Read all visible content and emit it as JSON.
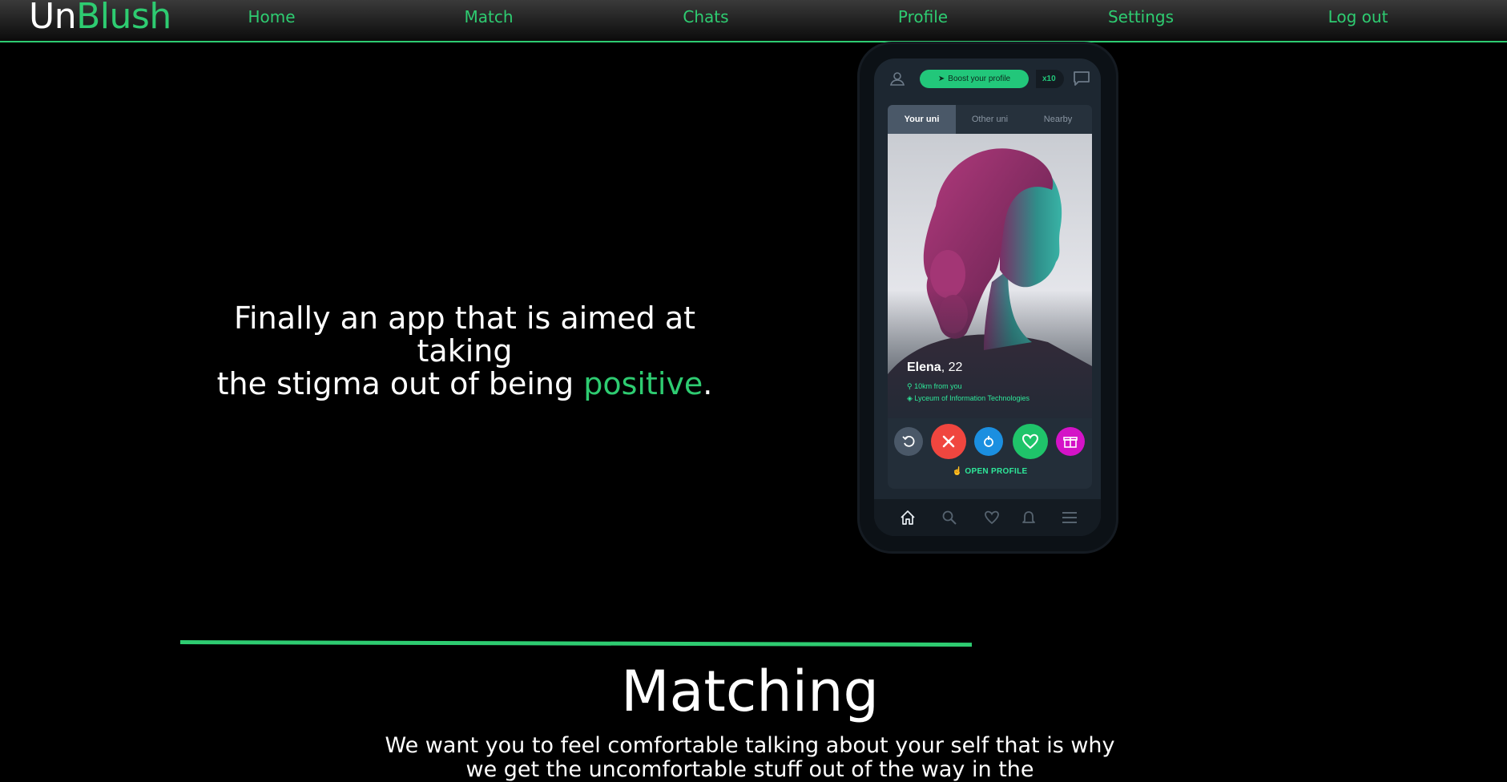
{
  "brand": {
    "part1": "Un",
    "part2": "Blush"
  },
  "nav": [
    {
      "label": "Home"
    },
    {
      "label": "Match"
    },
    {
      "label": "Chats"
    },
    {
      "label": "Profile"
    },
    {
      "label": "Settings"
    },
    {
      "label": "Log out"
    }
  ],
  "hero": {
    "line1": "Finally an app that is aimed at taking",
    "line2_prefix": "the stigma out of being ",
    "line2_accent": "positive",
    "line2_suffix": "."
  },
  "phone": {
    "boost_label": "Boost your profile",
    "boost_count": "x10",
    "tabs": [
      {
        "label": "Your uni",
        "active": true
      },
      {
        "label": "Other uni",
        "active": false
      },
      {
        "label": "Nearby",
        "active": false
      }
    ],
    "profile": {
      "name": "Elena",
      "age": ", 22",
      "distance": "10km from you",
      "school": "Lyceum of Information Technologies"
    },
    "open_profile_label": "OPEN PROFILE",
    "action_icons": [
      "undo-icon",
      "close-icon",
      "super-like-icon",
      "heart-icon",
      "gift-icon"
    ],
    "bottom_nav_icons": [
      "home-icon",
      "search-icon",
      "heart-icon",
      "bell-icon",
      "menu-icon"
    ]
  },
  "section": {
    "title": "Matching",
    "body": "We want you to feel comfortable talking about your self that is why we get the uncomfortable stuff out of the way in the"
  },
  "colors": {
    "accent": "#2ecc71",
    "background": "#000000",
    "phone_screen": "#1d2731",
    "dislike": "#f0463f",
    "super_like": "#1b8fe0",
    "like": "#1fc46a",
    "gift": "#d413c7"
  }
}
